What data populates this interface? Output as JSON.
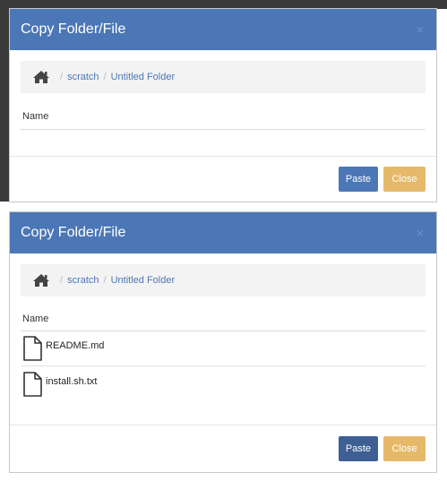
{
  "dialogs": [
    {
      "title": "Copy Folder/File",
      "close_glyph": "×",
      "breadcrumb": {
        "home_icon": "home-icon",
        "separator": "/",
        "items": [
          "scratch",
          "Untitled Folder"
        ]
      },
      "column_header": "Name",
      "files": [],
      "buttons": {
        "paste": "Paste",
        "close": "Close"
      }
    },
    {
      "title": "Copy Folder/File",
      "close_glyph": "×",
      "breadcrumb": {
        "home_icon": "home-icon",
        "separator": "/",
        "items": [
          "scratch",
          "Untitled Folder"
        ]
      },
      "column_header": "Name",
      "files": [
        {
          "name": "README.md",
          "icon": "file-icon"
        },
        {
          "name": "install.sh.txt",
          "icon": "file-icon"
        }
      ],
      "buttons": {
        "paste": "Paste",
        "close": "Close"
      }
    }
  ],
  "colors": {
    "header": "#4c77b6",
    "link": "#4c77b6",
    "paste_button": "#4c77b6",
    "paste_button_active": "#3e5f94",
    "close_button": "#e6b96a",
    "breadcrumb_bg": "#f3f3f3",
    "backdrop": "#3a3a3a"
  }
}
